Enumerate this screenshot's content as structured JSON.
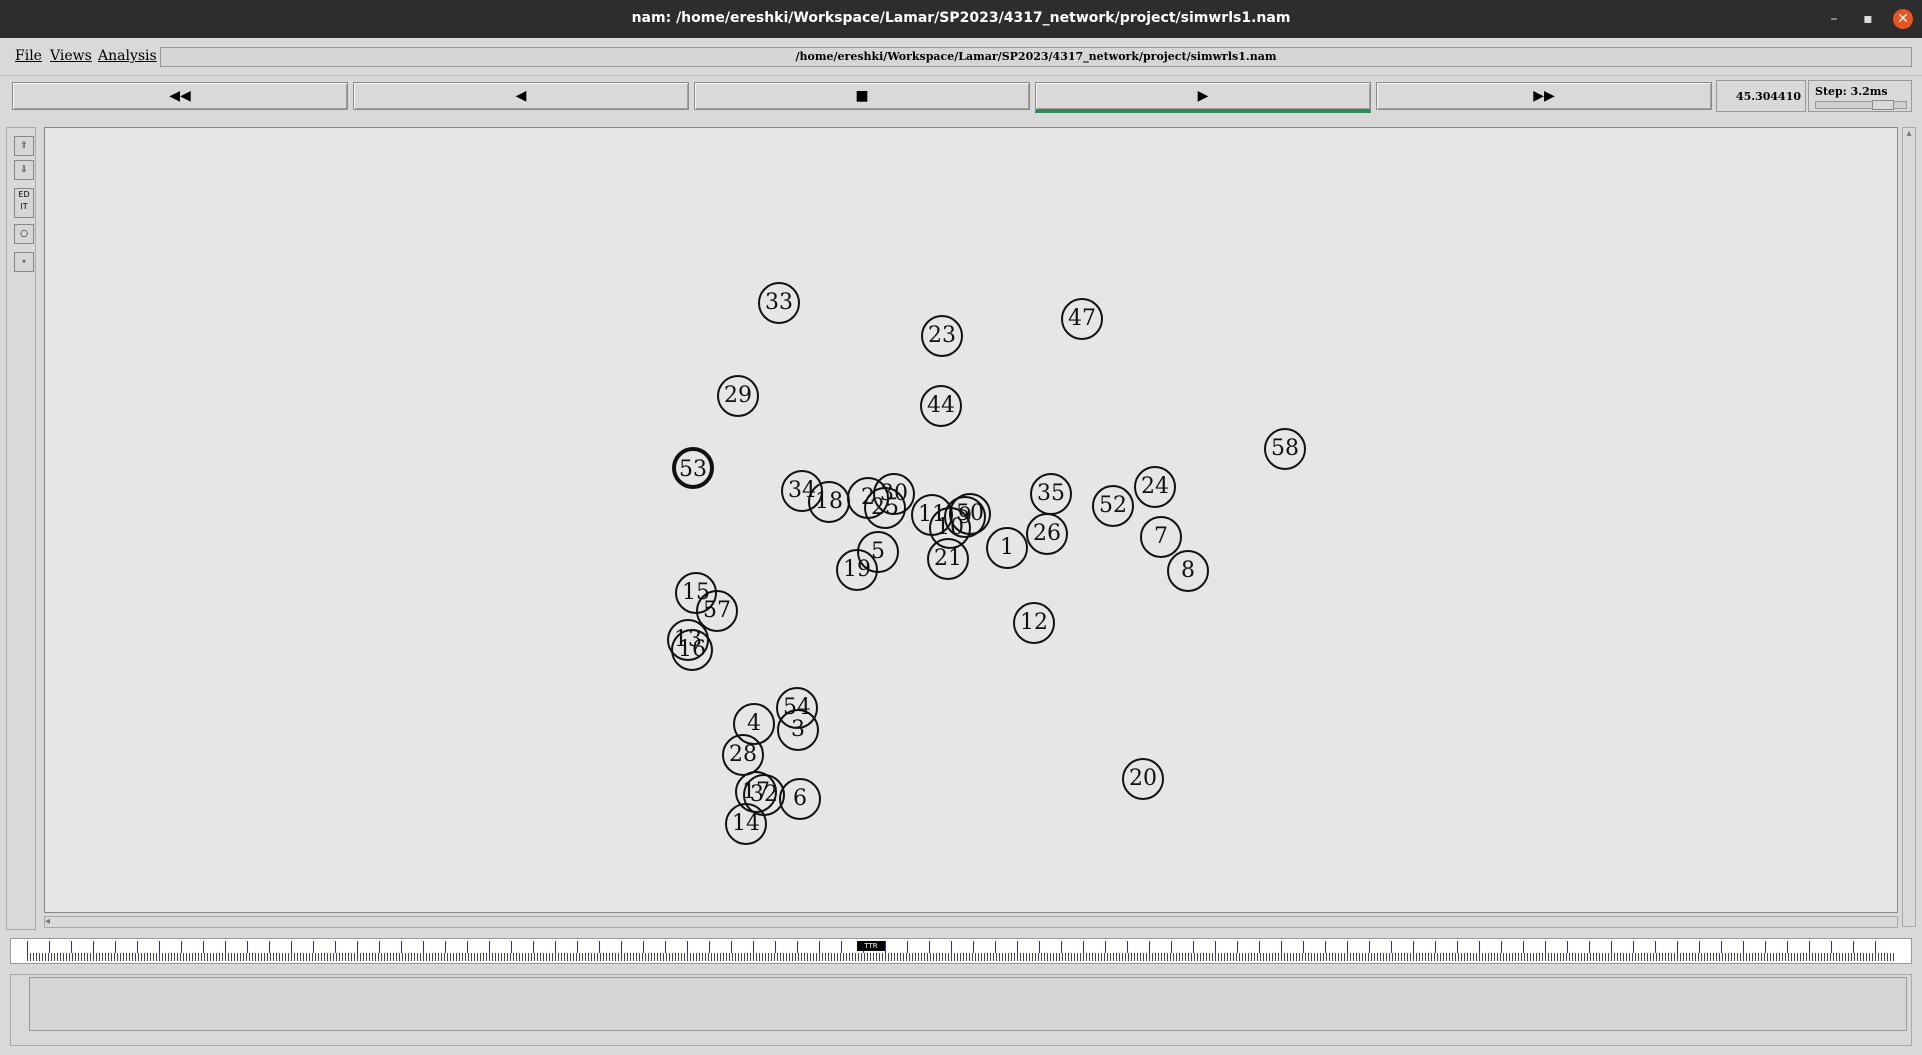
{
  "window": {
    "title": "nam: /home/ereshki/Workspace/Lamar/SP2023/4317_network/project/simwrls1.nam",
    "minimize_label": "–",
    "maximize_label": "▪",
    "close_label": "✕"
  },
  "menu": {
    "file_label": "File",
    "views_label": "Views",
    "analysis_label": "Analysis",
    "path": "/home/ereshki/Workspace/Lamar/SP2023/4317_network/project/simwrls1.nam"
  },
  "controls": {
    "rewind_label": "◀◀",
    "back_label": "◀",
    "stop_label": "■",
    "play_label": "▶",
    "fastforward_label": "▶▶",
    "time_value": "45.304410",
    "step_label": "Step: 3.2ms",
    "step_slider_fraction": 0.6
  },
  "tools": {
    "edit_label": "ED IT"
  },
  "nodes": [
    "33",
    "23",
    "47",
    "29",
    "44",
    "58",
    "53",
    "34",
    "18",
    "2",
    "30",
    "25",
    "11",
    "9",
    "50",
    "10",
    "21",
    "5",
    "19",
    "35",
    "1",
    "24",
    "52",
    "7",
    "26",
    "8",
    "15",
    "57",
    "13",
    "16",
    "12",
    "54",
    "4",
    "3",
    "28",
    "17",
    "32",
    "6",
    "14",
    "20"
  ],
  "timeline": {
    "marker_label": "TTR"
  }
}
